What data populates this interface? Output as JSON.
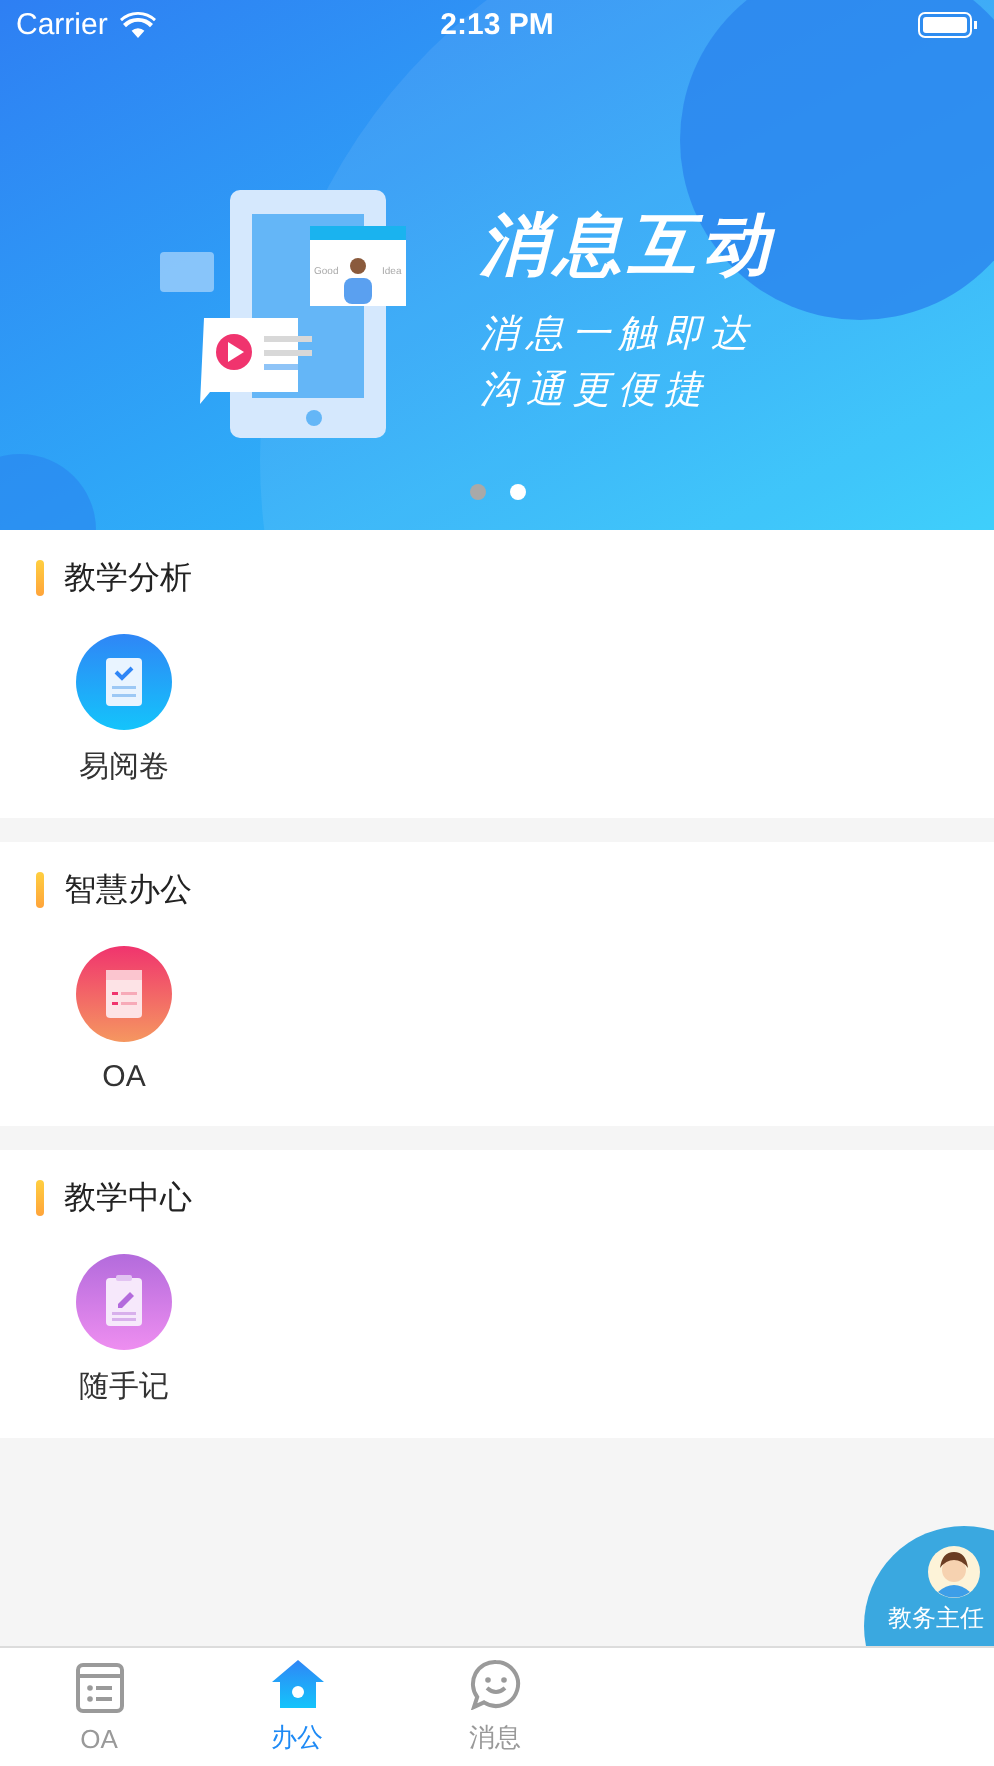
{
  "status_bar": {
    "carrier": "Carrier",
    "time": "2:13 PM"
  },
  "banner": {
    "title": "消息互动",
    "subtitle_lines": [
      "消息一触即达",
      "沟通更便捷"
    ],
    "illustration_labels": [
      "Good",
      "Idea"
    ],
    "page_dots": [
      {
        "selected": false
      },
      {
        "selected": true
      }
    ]
  },
  "sections": [
    {
      "title": "教学分析",
      "apps": [
        {
          "label": "易阅卷",
          "kind": "exam"
        }
      ]
    },
    {
      "title": "智慧办公",
      "apps": [
        {
          "label": "OA",
          "kind": "oa"
        }
      ]
    },
    {
      "title": "教学中心",
      "apps": [
        {
          "label": "随手记",
          "kind": "notes"
        }
      ]
    }
  ],
  "floating_button": {
    "label": "教务主任"
  },
  "tab_bar": [
    {
      "label": "OA",
      "kind": "oa",
      "selected": false
    },
    {
      "label": "办公",
      "kind": "home",
      "selected": true
    },
    {
      "label": "消息",
      "kind": "chat",
      "selected": false
    }
  ]
}
